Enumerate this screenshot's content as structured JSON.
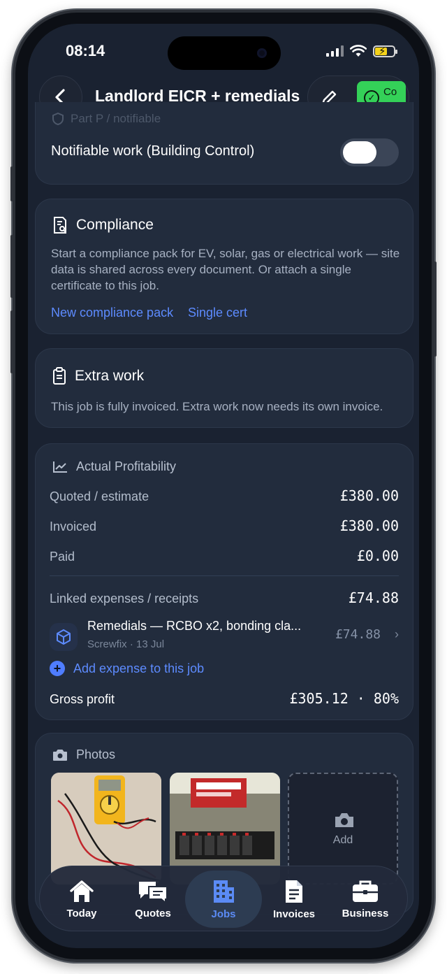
{
  "status_bar": {
    "time": "08:14"
  },
  "header": {
    "title": "Landlord EICR + remedials",
    "status_label": "Co\n..."
  },
  "part_p": {
    "section_label": "Part P / notifiable",
    "toggle_label": "Notifiable work (Building Control)",
    "toggle_on": false
  },
  "compliance": {
    "title": "Compliance",
    "description": "Start a compliance pack for EV, solar, gas or electrical work — site data is shared across every document. Or attach a single certificate to this job.",
    "new_pack": "New compliance pack",
    "single_cert": "Single cert"
  },
  "extra_work": {
    "title": "Extra work",
    "description": "This job is fully invoiced. Extra work now needs its own invoice."
  },
  "profitability": {
    "title": "Actual Profitability",
    "quoted_label": "Quoted / estimate",
    "quoted_value": "£380.00",
    "invoiced_label": "Invoiced",
    "invoiced_value": "£380.00",
    "paid_label": "Paid",
    "paid_value": "£0.00",
    "expenses_label": "Linked expenses / receipts",
    "expenses_value": "£74.88",
    "expense_item": {
      "name": "Remedials — RCBO x2, bonding cla...",
      "meta": "Screwfix · 13 Jul",
      "amount": "£74.88"
    },
    "add_expense": "Add expense to this job",
    "gross_label": "Gross profit",
    "gross_value": "£305.12 · 80%"
  },
  "photos": {
    "title": "Photos",
    "add_label": "Add"
  },
  "tabs": [
    {
      "label": "Today",
      "icon": "home-icon"
    },
    {
      "label": "Quotes",
      "icon": "chat-bubbles-icon"
    },
    {
      "label": "Jobs",
      "icon": "building-icon",
      "active": true
    },
    {
      "label": "Invoices",
      "icon": "document-icon"
    },
    {
      "label": "Business",
      "icon": "briefcase-icon"
    }
  ],
  "colors": {
    "accent": "#5d8bff",
    "status_green": "#34d158",
    "card_bg": "#222c3d",
    "screen_bg": "#1a2231"
  }
}
